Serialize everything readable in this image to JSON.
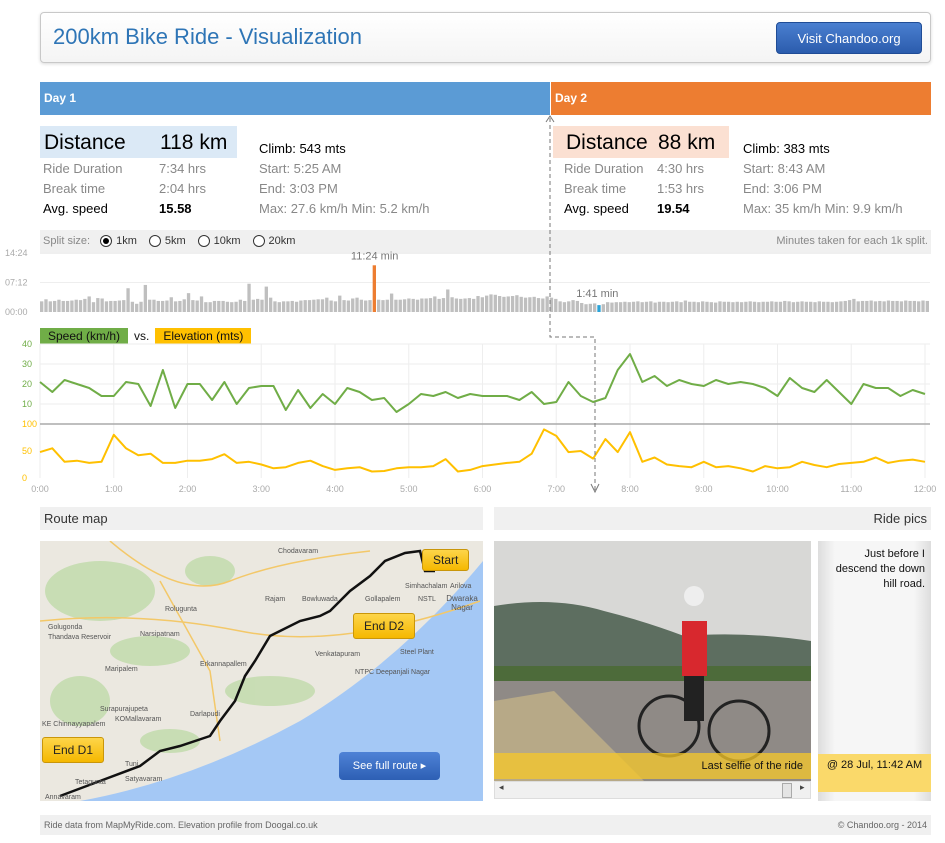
{
  "header": {
    "title": "200km Bike Ride - Visualization",
    "visit_button": "Visit Chandoo.org"
  },
  "days": [
    {
      "label": "Day 1",
      "color": "#5b9bd5",
      "distance_label": "Distance",
      "distance": "118 km",
      "ride_duration_label": "Ride Duration",
      "ride_duration": "7:34 hrs",
      "break_label": "Break time",
      "break_time": "2:04 hrs",
      "avg_label": "Avg. speed",
      "avg_speed": "15.58",
      "climb": "Climb: 543 mts",
      "start": "Start: 5:25 AM",
      "end": "End: 3:03 PM",
      "maxmin": "Max: 27.6 km/h Min: 5.2 km/h"
    },
    {
      "label": "Day 2",
      "color": "#ed7d31",
      "distance_label": "Distance",
      "distance": "88 km",
      "ride_duration_label": "Ride Duration",
      "ride_duration": "4:30 hrs",
      "break_label": "Break time",
      "break_time": "1:53 hrs",
      "avg_label": "Avg. speed",
      "avg_speed": "19.54",
      "climb": "Climb: 383 mts",
      "start": "Start: 8:43 AM",
      "end": "End: 3:06 PM",
      "maxmin": "Max: 35 km/h Min: 9.9 km/h"
    }
  ],
  "split": {
    "label": "Split size:",
    "options": [
      "1km",
      "5km",
      "10km",
      "20km"
    ],
    "selected": "1km",
    "note": "Minutes taken for each 1k split."
  },
  "chart_data": [
    {
      "type": "bar",
      "title": "",
      "yticks": [
        "14:24",
        "07:12",
        "00:00"
      ],
      "ylim_min": [
        0,
        14.4
      ],
      "max_label": "11:24 min",
      "min_label": "1:41 min",
      "max_color": "#ed7d31",
      "min_color": "#2aa3d8",
      "bar_color": "#bfbfbf",
      "values": [
        2.6,
        3.1,
        2.6,
        2.7,
        3.0,
        2.7,
        2.7,
        2.8,
        3.0,
        2.9,
        3.2,
        3.8,
        2.4,
        3.4,
        3.3,
        2.6,
        2.7,
        2.7,
        2.8,
        2.9,
        5.8,
        2.5,
        2.0,
        2.5,
        6.6,
        3.0,
        3.0,
        2.7,
        2.7,
        2.8,
        3.6,
        2.6,
        2.7,
        3.1,
        4.6,
        2.9,
        2.8,
        3.8,
        2.4,
        2.4,
        2.7,
        2.7,
        2.7,
        2.5,
        2.4,
        2.5,
        3.0,
        2.7,
        6.9,
        3.0,
        3.2,
        3.0,
        6.2,
        3.5,
        2.6,
        2.4,
        2.6,
        2.6,
        2.7,
        2.5,
        2.8,
        2.9,
        2.9,
        3.0,
        3.1,
        3.1,
        3.5,
        2.8,
        2.6,
        4.0,
        2.9,
        2.8,
        3.3,
        3.5,
        3.0,
        2.8,
        2.9,
        11.4,
        3.0,
        2.9,
        3.0,
        4.5,
        3.0,
        3.0,
        3.1,
        3.3,
        3.2,
        3.0,
        3.3,
        3.3,
        3.4,
        3.8,
        3.2,
        3.4,
        5.5,
        3.6,
        3.3,
        3.2,
        3.3,
        3.4,
        3.2,
        3.9,
        3.6,
        4.0,
        4.3,
        4.2,
        3.9,
        3.7,
        3.8,
        3.9,
        4.1,
        3.7,
        3.5,
        3.6,
        3.7,
        3.4,
        3.3,
        3.8,
        3.5,
        3.2,
        2.6,
        2.4,
        2.6,
        2.9,
        2.7,
        2.2,
        1.9,
        2.0,
        2.1,
        1.68,
        1.9,
        2.4,
        2.3,
        2.4,
        2.4,
        2.5,
        2.4,
        2.5,
        2.6,
        2.4,
        2.5,
        2.6,
        2.3,
        2.5,
        2.5,
        2.4,
        2.5,
        2.6,
        2.4,
        2.8,
        2.5,
        2.5,
        2.4,
        2.6,
        2.5,
        2.4,
        2.3,
        2.6,
        2.5,
        2.5,
        2.4,
        2.5,
        2.4,
        2.5,
        2.6,
        2.5,
        2.4,
        2.5,
        2.5,
        2.6,
        2.5,
        2.5,
        2.7,
        2.6,
        2.4,
        2.5,
        2.6,
        2.5,
        2.5,
        2.4,
        2.6,
        2.5,
        2.5,
        2.4,
        2.5,
        2.6,
        2.7,
        2.9,
        3.2,
        2.6,
        2.7,
        2.7,
        2.8,
        2.6,
        2.7,
        2.6,
        2.8,
        2.7,
        2.7,
        2.6,
        2.8,
        2.7,
        2.7,
        2.6,
        2.8,
        2.7
      ]
    },
    {
      "type": "line",
      "title": "",
      "legend": [
        {
          "label": "Speed (km/h)",
          "color": "#70ad47"
        },
        {
          "label": "Elevation (mts)",
          "color": "#ffc000"
        }
      ],
      "legend_vs": "vs.",
      "x_start_h": 0,
      "x_step_min": 10,
      "xticks": [
        "0:00",
        "1:00",
        "2:00",
        "3:00",
        "4:00",
        "5:00",
        "6:00",
        "7:00",
        "8:00",
        "9:00",
        "10:00",
        "11:00",
        "12:00"
      ],
      "speed": {
        "yticks": [
          40,
          30,
          20,
          10
        ],
        "ylim": [
          0,
          40
        ],
        "values": [
          21,
          16,
          22,
          20,
          18,
          14,
          14,
          21,
          20,
          9,
          27,
          8,
          20,
          20,
          12,
          21,
          10,
          18,
          19,
          19,
          7,
          17,
          8,
          15,
          10,
          18,
          16,
          12,
          13,
          6,
          10,
          15,
          14,
          16,
          13,
          15,
          14,
          14,
          14,
          12,
          16,
          10,
          11,
          21,
          14,
          11,
          13,
          27,
          35,
          21,
          24,
          19,
          22,
          20,
          19,
          22,
          20,
          21,
          20,
          18,
          14,
          23,
          18,
          16,
          22,
          16,
          10,
          20,
          18,
          18,
          14,
          17,
          15
        ]
      },
      "elevation": {
        "yticks": [
          100,
          50,
          0
        ],
        "ylim": [
          0,
          100
        ],
        "values": [
          48,
          55,
          30,
          32,
          28,
          30,
          80,
          55,
          42,
          45,
          28,
          28,
          32,
          32,
          35,
          44,
          28,
          30,
          25,
          18,
          20,
          28,
          32,
          22,
          15,
          18,
          20,
          12,
          13,
          18,
          20,
          20,
          22,
          35,
          12,
          15,
          22,
          25,
          28,
          30,
          45,
          90,
          78,
          48,
          50,
          36,
          72,
          48,
          85,
          30,
          38,
          25,
          22,
          20,
          30,
          20,
          22,
          18,
          12,
          22,
          18,
          20,
          30,
          24,
          20,
          26,
          28,
          30,
          38,
          28,
          32,
          34,
          30
        ]
      }
    }
  ],
  "route": {
    "title": "Route map",
    "see_full": "See full route",
    "callouts": [
      "Start",
      "End D2",
      "End D1"
    ],
    "places": [
      "Chodavaram",
      "Rajam",
      "Bowluwada",
      "Rolugunta",
      "Golugonda",
      "Thandava Reservoir",
      "Narsipatnam",
      "Erkannapallem",
      "Maripalem",
      "Venkatapuram",
      "NTPC Deepanjali Nagar",
      "Steel Plant",
      "Simhachalam",
      "Arilova",
      "NSTL",
      "Dwaraka Nagar",
      "Gollapalem",
      "Surapurajupeta",
      "KOMallavaram",
      "Darlapudi",
      "KE Chinnayyapalem",
      "Tuni",
      "Satyavaram",
      "Annavaram",
      "Tetagunta"
    ]
  },
  "pics": {
    "title": "Ride pics",
    "photo_caption": "Last selfie of the  ride",
    "side_text": "Just before I descend the down hill road.",
    "timestamp": "@ 28 Jul, 11:42 AM"
  },
  "footer": {
    "left": "Ride data from MapMyRide.com. Elevation profile from Doogal.co.uk",
    "right": "© Chandoo.org - 2014"
  }
}
